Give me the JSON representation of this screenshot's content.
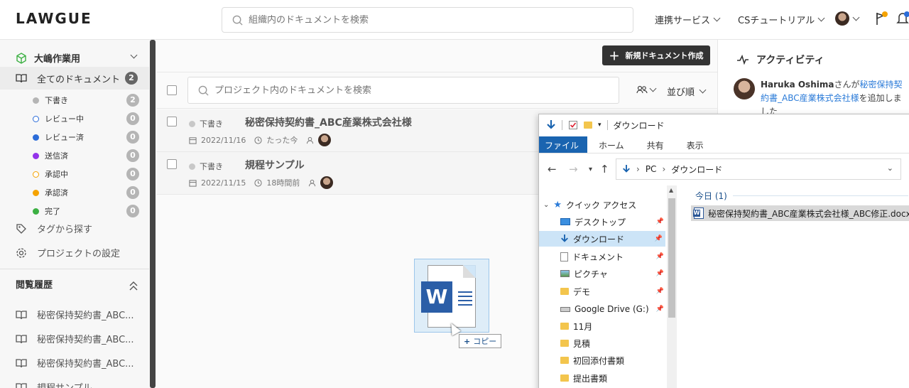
{
  "header": {
    "logo": "LAWGUE",
    "search_placeholder": "組織内のドキュメントを検索",
    "nav_integrations": "連携サービス",
    "nav_org": "CSチュートリアル"
  },
  "sidebar": {
    "workspace": "大嶋作業用",
    "all_docs": {
      "label": "全てのドキュメント",
      "count": "2"
    },
    "statuses": [
      {
        "label": "下書き",
        "count": "2",
        "color": "#b5b5b5",
        "hollow": false
      },
      {
        "label": "レビュー中",
        "count": "0",
        "color": "#2b6cd8",
        "hollow": true
      },
      {
        "label": "レビュー済",
        "count": "0",
        "color": "#2b6cd8",
        "hollow": false
      },
      {
        "label": "送信済",
        "count": "0",
        "color": "#9333ea",
        "hollow": false
      },
      {
        "label": "承認中",
        "count": "0",
        "color": "#f5a300",
        "hollow": true
      },
      {
        "label": "承認済",
        "count": "0",
        "color": "#f5a300",
        "hollow": false
      },
      {
        "label": "完了",
        "count": "0",
        "color": "#3cb043",
        "hollow": false
      }
    ],
    "tags_link": "タグから探す",
    "settings_link": "プロジェクトの設定",
    "history_title": "閲覧履歴",
    "history": [
      "秘密保持契約書_ABC...",
      "秘密保持契約書_ABC...",
      "秘密保持契約書_ABC...",
      "規程サンプル"
    ]
  },
  "main": {
    "new_doc_button": "新規ドキュメント作成",
    "search_placeholder": "プロジェクト内のドキュメントを検索",
    "sort_label": "並び順",
    "documents": [
      {
        "status": "下書き",
        "title": "秘密保持契約書_ABC産業株式会社様",
        "date": "2022/11/16",
        "updated": "たった今"
      },
      {
        "status": "下書き",
        "title": "規程サンプル",
        "date": "2022/11/15",
        "updated": "18時間前"
      }
    ]
  },
  "activity": {
    "title": "アクティビティ",
    "user": "Haruka Oshima",
    "text_san": "さんが",
    "link": "秘密保持契約書_ABC産業株式会社様",
    "text_tail": "を追加しました"
  },
  "explorer": {
    "window_title": "ダウンロード",
    "ribbon_tabs": [
      "ファイル",
      "ホーム",
      "共有",
      "表示"
    ],
    "path": [
      "PC",
      "ダウンロード"
    ],
    "quick_access": "クイック アクセス",
    "tree": [
      "デスクトップ",
      "ダウンロード",
      "ドキュメント",
      "ピクチャ",
      "デモ",
      "Google Drive (G:)",
      "11月",
      "見積",
      "初回添付書類",
      "提出書類"
    ],
    "group": "今日 (1)",
    "file": "秘密保持契約書_ABC産業株式会社様_ABC修正.docx"
  },
  "drag": {
    "copy_label": "コピー"
  }
}
